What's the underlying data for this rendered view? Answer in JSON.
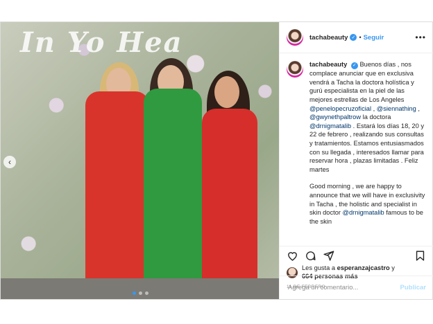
{
  "post": {
    "username": "tachabeauty",
    "follow_label": "Seguir",
    "more_icon": "ellipsis-icon",
    "caption_parts": {
      "intro": "Buenos días , nos complace anunciar que en exclusiva vendrá a Tacha la doctora holística y gurú especialista en la piel de las mejores estrellas de Los Angeles ",
      "m1": "@penelopecruzoficial",
      "sep1": " , ",
      "m2": "@siennathing",
      "sep2": " , ",
      "m3": "@gwynethpaltrow",
      "mid": " la doctora ",
      "m4": "@drnigmatalib",
      "rest": " . Estará los días 18, 20 y 22 de febrero , realizando sus consultas y tratamientos. Estamos entusiasmados con su llegada , interesados llamar para reservar hora , plazas limitadas . Feliz martes",
      "english_a": "Good morning , we are happy to announce that we will have in exclusivity in Tacha , the holistic and specialist in skin doctor ",
      "m5": "@drnigmatalib",
      "english_b": " famous to be the skin"
    },
    "photo_sign": "In Yo Hea",
    "likes_line1": "Les gusta a ",
    "likes_user": "esperanzajcastro",
    "likes_line2": " y",
    "likes_count": "664 personas más",
    "date": "11 DE FEBRERO",
    "comment_placeholder": "Agrega un comentario...",
    "publish_label": "Publicar"
  }
}
